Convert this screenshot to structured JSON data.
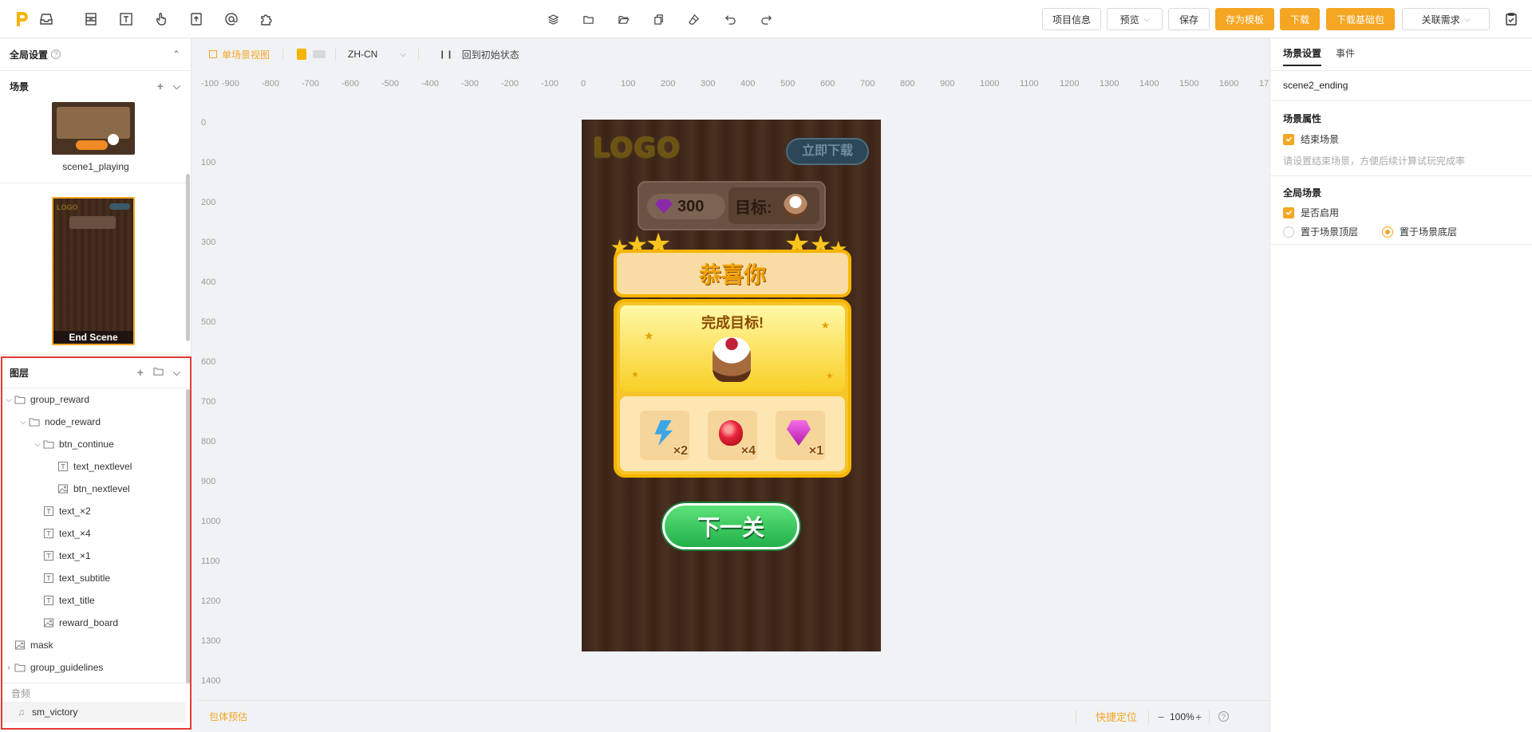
{
  "toolbar": {
    "project_info": "项目信息",
    "preview": "预览",
    "save": "保存",
    "save_template": "存为模板",
    "download": "下载",
    "download_base": "下载基础包",
    "related_req": "关联需求"
  },
  "left": {
    "global_settings": "全局设置",
    "scenes_title": "场景",
    "scenes": [
      {
        "label": "scene1_playing"
      },
      {
        "label": "End Scene"
      }
    ],
    "layers_title": "图层",
    "tree": [
      {
        "label": "group_reward",
        "icon": "folder-icon",
        "expand": "open"
      },
      {
        "label": "node_reward",
        "icon": "folder-icon",
        "expand": "open"
      },
      {
        "label": "btn_continue",
        "icon": "folder-icon",
        "expand": "open"
      },
      {
        "label": "text_nextlevel",
        "icon": "text-icon",
        "expand": ""
      },
      {
        "label": "btn_nextlevel",
        "icon": "image-icon",
        "expand": ""
      },
      {
        "label": "text_×2",
        "icon": "text-icon",
        "expand": ""
      },
      {
        "label": "text_×4",
        "icon": "text-icon",
        "expand": ""
      },
      {
        "label": "text_×1",
        "icon": "text-icon",
        "expand": ""
      },
      {
        "label": "text_subtitle",
        "icon": "text-icon",
        "expand": ""
      },
      {
        "label": "text_title",
        "icon": "text-icon",
        "expand": ""
      },
      {
        "label": "reward_board",
        "icon": "image-icon",
        "expand": ""
      },
      {
        "label": "mask",
        "icon": "image-icon",
        "expand": ""
      },
      {
        "label": "group_guidelines",
        "icon": "folder-icon",
        "expand": "closed"
      }
    ],
    "audio_title": "音频",
    "audio_item": "sm_victory"
  },
  "editor": {
    "single_view": "单场景视图",
    "lang": "ZH-CN",
    "reset": "回到初始状态",
    "size_estimate": "包体预估",
    "quick_locate": "快捷定位",
    "zoom": "100%",
    "ruler_h": [
      "-100",
      "-900",
      "-800",
      "-700",
      "-600",
      "-500",
      "-400",
      "-300",
      "-200",
      "-100",
      "0",
      "100",
      "200",
      "300",
      "400",
      "500",
      "600",
      "700",
      "800",
      "900",
      "1000",
      "1100",
      "1200",
      "1300",
      "1400",
      "1500",
      "1600",
      "17"
    ],
    "ruler_v": [
      "0",
      "100",
      "200",
      "300",
      "400",
      "500",
      "600",
      "700",
      "800",
      "900",
      "1000",
      "1100",
      "1200",
      "1300",
      "1400"
    ]
  },
  "game": {
    "logo": "LOGO",
    "download_now": "立即下载",
    "gems": "300",
    "target": "目标:",
    "congrats": "恭喜你",
    "complete": "完成目标!",
    "rewards": [
      {
        "count": "×2",
        "icon": "lightning-icon"
      },
      {
        "count": "×4",
        "icon": "heart-icon"
      },
      {
        "count": "×1",
        "icon": "gem-icon"
      }
    ],
    "next_level": "下一关"
  },
  "right": {
    "tab_scene": "场景设置",
    "tab_event": "事件",
    "scene_name": "scene2_ending",
    "scene_props": "场景属性",
    "end_scene": "结束场景",
    "end_hint": "请设置结束场景，方便后续计算试玩完成率",
    "global_scene": "全局场景",
    "enable": "是否启用",
    "top_layer": "置于场景顶层",
    "bottom_layer": "置于场景底层"
  },
  "colors": {
    "accent": "#f5a623",
    "outline": "#e53935",
    "green": "#34c759"
  }
}
